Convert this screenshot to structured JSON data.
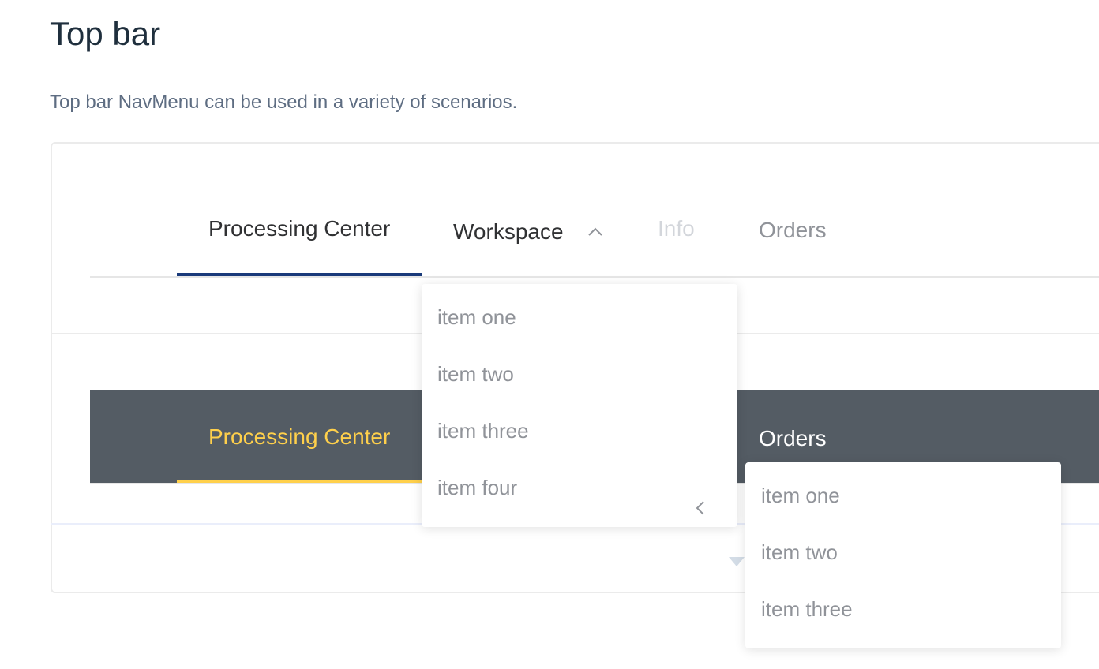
{
  "page": {
    "title": "Top bar",
    "description": "Top bar NavMenu can be used in a variety of scenarios."
  },
  "menu_light": {
    "items": [
      {
        "label": "Processing Center",
        "state": "active"
      },
      {
        "label": "Workspace",
        "state": "open",
        "icon": "chevron-up-icon"
      },
      {
        "label": "Info",
        "state": "disabled"
      },
      {
        "label": "Orders",
        "state": "default"
      }
    ],
    "active_color": "#1a3a7a",
    "submenu": {
      "items": [
        {
          "label": "item one"
        },
        {
          "label": "item two"
        },
        {
          "label": "item three"
        },
        {
          "label": "item four",
          "icon": "chevron-left-icon"
        }
      ]
    }
  },
  "menu_dark": {
    "background": "#545c64",
    "active_color": "#ffd04b",
    "items": [
      {
        "label": "Processing Center",
        "state": "active"
      },
      {
        "label": "Orders",
        "state": "default"
      }
    ],
    "submenu": {
      "items": [
        {
          "label": "item one"
        },
        {
          "label": "item two"
        },
        {
          "label": "item three"
        }
      ]
    }
  },
  "code_toggle": {
    "icon": "caret-down-icon"
  }
}
